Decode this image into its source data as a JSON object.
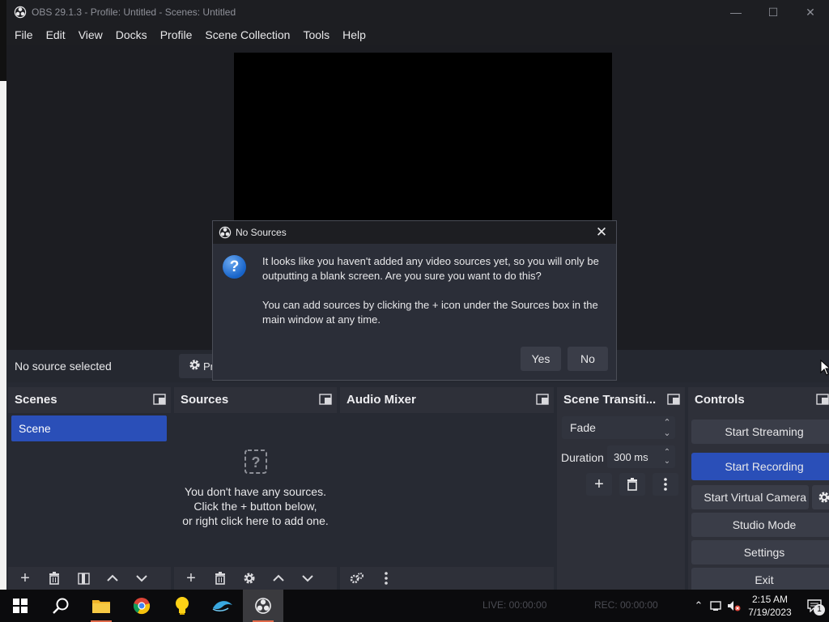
{
  "window": {
    "title": "OBS 29.1.3 - Profile: Untitled - Scenes: Untitled",
    "controls": [
      "—",
      "☐",
      "✕"
    ]
  },
  "menu": [
    "File",
    "Edit",
    "View",
    "Docks",
    "Profile",
    "Scene Collection",
    "Tools",
    "Help"
  ],
  "source_bar": {
    "status": "No source selected",
    "properties_label": "Pr"
  },
  "docks": {
    "scenes": {
      "title": "Scenes",
      "items": [
        "Scene"
      ]
    },
    "sources": {
      "title": "Sources",
      "empty_lines": [
        "You don't have any sources.",
        "Click the + button below,",
        "or right click here to add one."
      ]
    },
    "audio": {
      "title": "Audio Mixer"
    },
    "transitions": {
      "title": "Scene Transiti...",
      "selected": "Fade",
      "duration_label": "Duration",
      "duration_value": "300 ms"
    },
    "controls": {
      "title": "Controls",
      "buttons": {
        "stream": "Start Streaming",
        "record": "Start Recording",
        "virtual_cam": "Start Virtual Camera",
        "studio": "Studio Mode",
        "settings": "Settings",
        "exit": "Exit"
      }
    }
  },
  "dialog": {
    "title": "No Sources",
    "message": "It looks like you haven't added any video sources yet, so you will only be outputting a blank screen. Are you sure you want to do this?",
    "hint": "You can add sources by clicking the + icon under the Sources box in the main window at any time.",
    "yes": "Yes",
    "no": "No"
  },
  "status_bar": {
    "live": "LIVE: 00:00:00",
    "rec": "REC: 00:00:00"
  },
  "taskbar": {
    "time": "2:15 AM",
    "date": "7/19/2023",
    "notification_count": "1"
  },
  "colors": {
    "accent": "#2a4fb8",
    "panel": "#2e3039",
    "background": "#272a33"
  }
}
